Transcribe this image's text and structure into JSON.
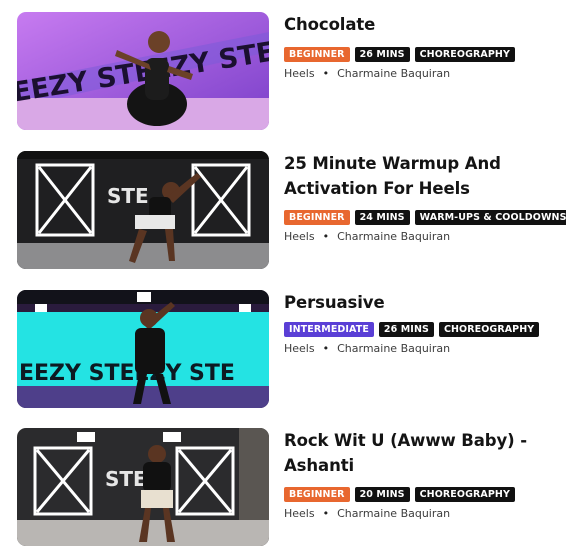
{
  "classes": [
    {
      "title": "Chocolate",
      "level": "BEGINNER",
      "level_color": "#e8672f",
      "duration": "26 MINS",
      "category": "CHOREOGRAPHY",
      "style": "Heels",
      "separator": "•",
      "instructor": "Charmaine Baquiran",
      "thumb_text": "EEZY STEEZY STE"
    },
    {
      "title": "25 Minute Warmup And Activation For Heels",
      "level": "BEGINNER",
      "level_color": "#e8672f",
      "duration": "24 MINS",
      "category": "WARM-UPS & COOLDOWNS",
      "style": "Heels",
      "separator": "•",
      "instructor": "Charmaine Baquiran",
      "thumb_text": "STE"
    },
    {
      "title": "Persuasive",
      "level": "INTERMEDIATE",
      "level_color": "#5a3fd6",
      "duration": "26 MINS",
      "category": "CHOREOGRAPHY",
      "style": "Heels",
      "separator": "•",
      "instructor": "Charmaine Baquiran",
      "thumb_text": "EEZY STEEZY STE"
    },
    {
      "title": "Rock Wit U (Awww Baby) - Ashanti",
      "level": "BEGINNER",
      "level_color": "#e8672f",
      "duration": "20 MINS",
      "category": "CHOREOGRAPHY",
      "style": "Heels",
      "separator": "•",
      "instructor": "Charmaine Baquiran",
      "thumb_text": "STE"
    }
  ]
}
